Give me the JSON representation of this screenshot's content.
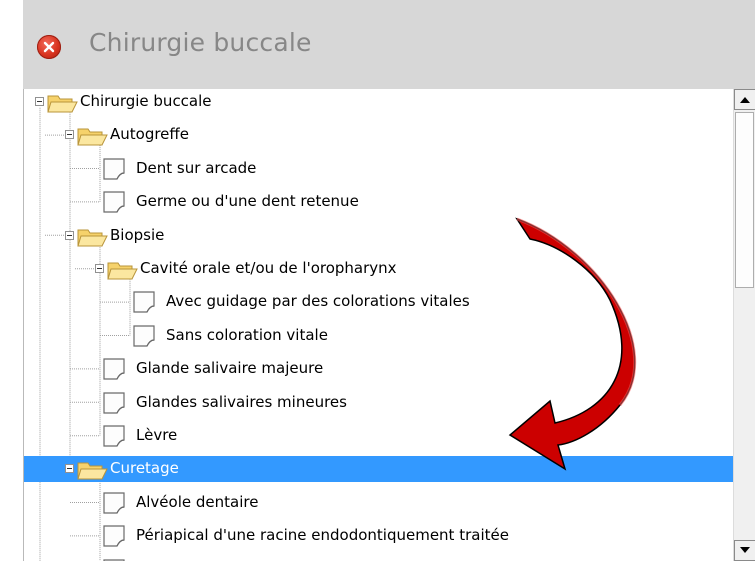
{
  "window": {
    "title": "Chirurgie buccale"
  },
  "tree": [
    {
      "label": "Chirurgie buccale",
      "depth": 0,
      "type": "folder",
      "expanded": true
    },
    {
      "label": "Autogreffe",
      "depth": 1,
      "type": "folder",
      "expanded": true
    },
    {
      "label": "Dent sur arcade",
      "depth": 2,
      "type": "document"
    },
    {
      "label": "Germe ou d'une dent retenue",
      "depth": 2,
      "type": "document"
    },
    {
      "label": "Biopsie",
      "depth": 1,
      "type": "folder",
      "expanded": true
    },
    {
      "label": "Cavité orale et/ou de l'oropharynx",
      "depth": 2,
      "type": "folder",
      "expanded": true
    },
    {
      "label": "Avec guidage par des colorations vitales",
      "depth": 3,
      "type": "document"
    },
    {
      "label": "Sans coloration vitale",
      "depth": 3,
      "type": "document"
    },
    {
      "label": "Glande salivaire majeure",
      "depth": 2,
      "type": "document"
    },
    {
      "label": "Glandes salivaires mineures",
      "depth": 2,
      "type": "document"
    },
    {
      "label": "Lèvre",
      "depth": 2,
      "type": "document"
    },
    {
      "label": "Curetage",
      "depth": 1,
      "type": "folder",
      "expanded": true,
      "selected": true
    },
    {
      "label": "Alvéole dentaire",
      "depth": 2,
      "type": "document"
    },
    {
      "label": "Périapical d'une racine endodontiquement traitée",
      "depth": 2,
      "type": "document"
    },
    {
      "label": "",
      "depth": 2,
      "type": "document"
    }
  ],
  "colors": {
    "selection": "#3399ff",
    "arrow": "#cc0000",
    "folder": "#f6d26b"
  },
  "icons": {
    "close": "close-icon",
    "folder": "folder-icon",
    "document": "document-icon",
    "annotation": "curved-arrow-icon"
  }
}
